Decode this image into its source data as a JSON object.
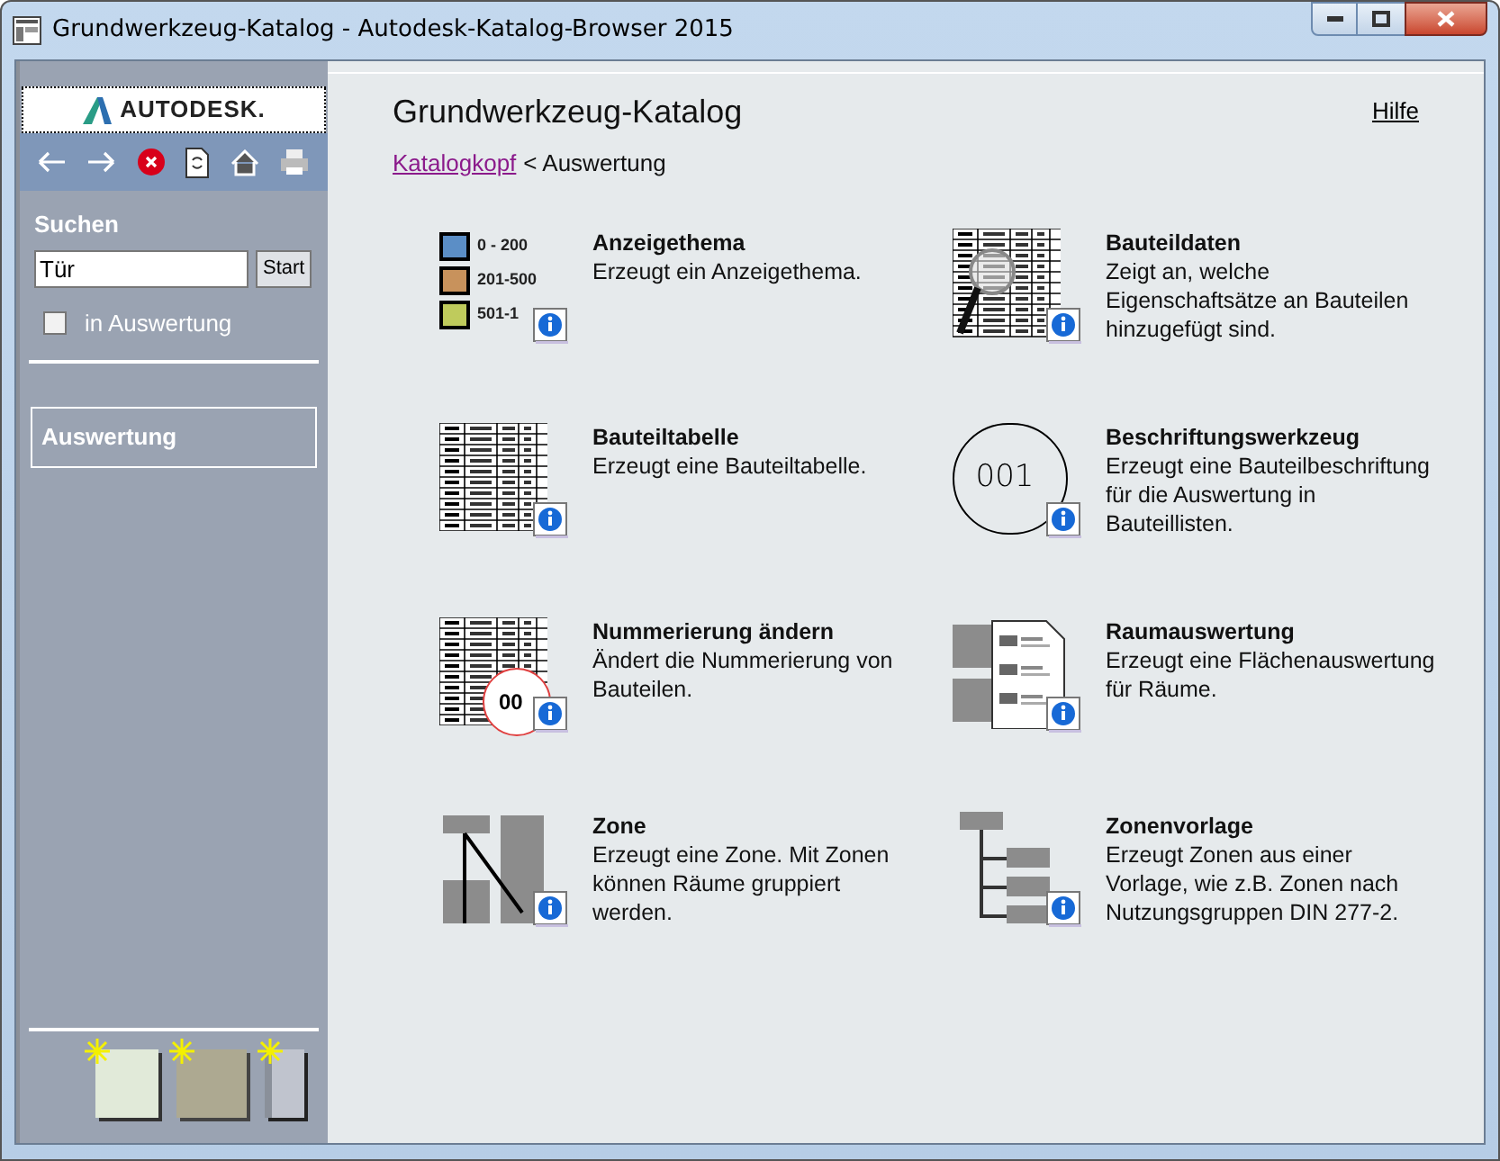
{
  "window": {
    "title": "Grundwerkzeug-Katalog - Autodesk-Katalog-Browser 2015"
  },
  "sidebar": {
    "logo": "AUTODESK.",
    "search_label": "Suchen",
    "search_value": "Tür",
    "search_button": "Start",
    "checkbox": {
      "label": "in Auswertung",
      "checked": false
    },
    "items": [
      {
        "label": "Auswertung",
        "selected": true
      }
    ]
  },
  "page": {
    "title": "Grundwerkzeug-Katalog",
    "help": "Hilfe",
    "breadcrumb_link": "Katalogkopf",
    "breadcrumb_rest": "< Auswertung"
  },
  "tools": [
    {
      "kind": "legend",
      "title": "Anzeigethema",
      "description": "Erzeugt ein Anzeigethema.",
      "legend": [
        {
          "label": "0 - 200",
          "color": "#5b8ec6"
        },
        {
          "label": "201-500",
          "color": "#c8925c"
        },
        {
          "label": "501-1",
          "color": "#bfcb5c"
        }
      ]
    },
    {
      "kind": "table-magnifier",
      "title": "Bauteildaten",
      "description": "Zeigt an, welche Eigenschaftsätze an Bauteilen hinzugefügt sind."
    },
    {
      "kind": "table",
      "title": "Bauteiltabelle",
      "description": "Erzeugt eine Bauteiltabelle."
    },
    {
      "kind": "circle-number",
      "title": "Beschriftungswerkzeug",
      "description": "Erzeugt eine Bauteilbeschriftung für die Auswertung in Bauteillisten.",
      "icon_text": "001"
    },
    {
      "kind": "table-number",
      "title": "Nummerierung ändern",
      "description": "Ändert die Nummerierung von Bauteilen.",
      "icon_text": "00"
    },
    {
      "kind": "room-report",
      "title": "Raumauswertung",
      "description": "Erzeugt eine Flächenauswertung für Räume."
    },
    {
      "kind": "zone",
      "title": "Zone",
      "description": "Erzeugt eine Zone. Mit Zonen können Räume gruppiert werden."
    },
    {
      "kind": "zone-template",
      "title": "Zonenvorlage",
      "description": "Erzeugt Zonen aus einer Vorlage, wie z.B. Zonen nach Nutzungsgruppen DIN 277-2."
    }
  ]
}
